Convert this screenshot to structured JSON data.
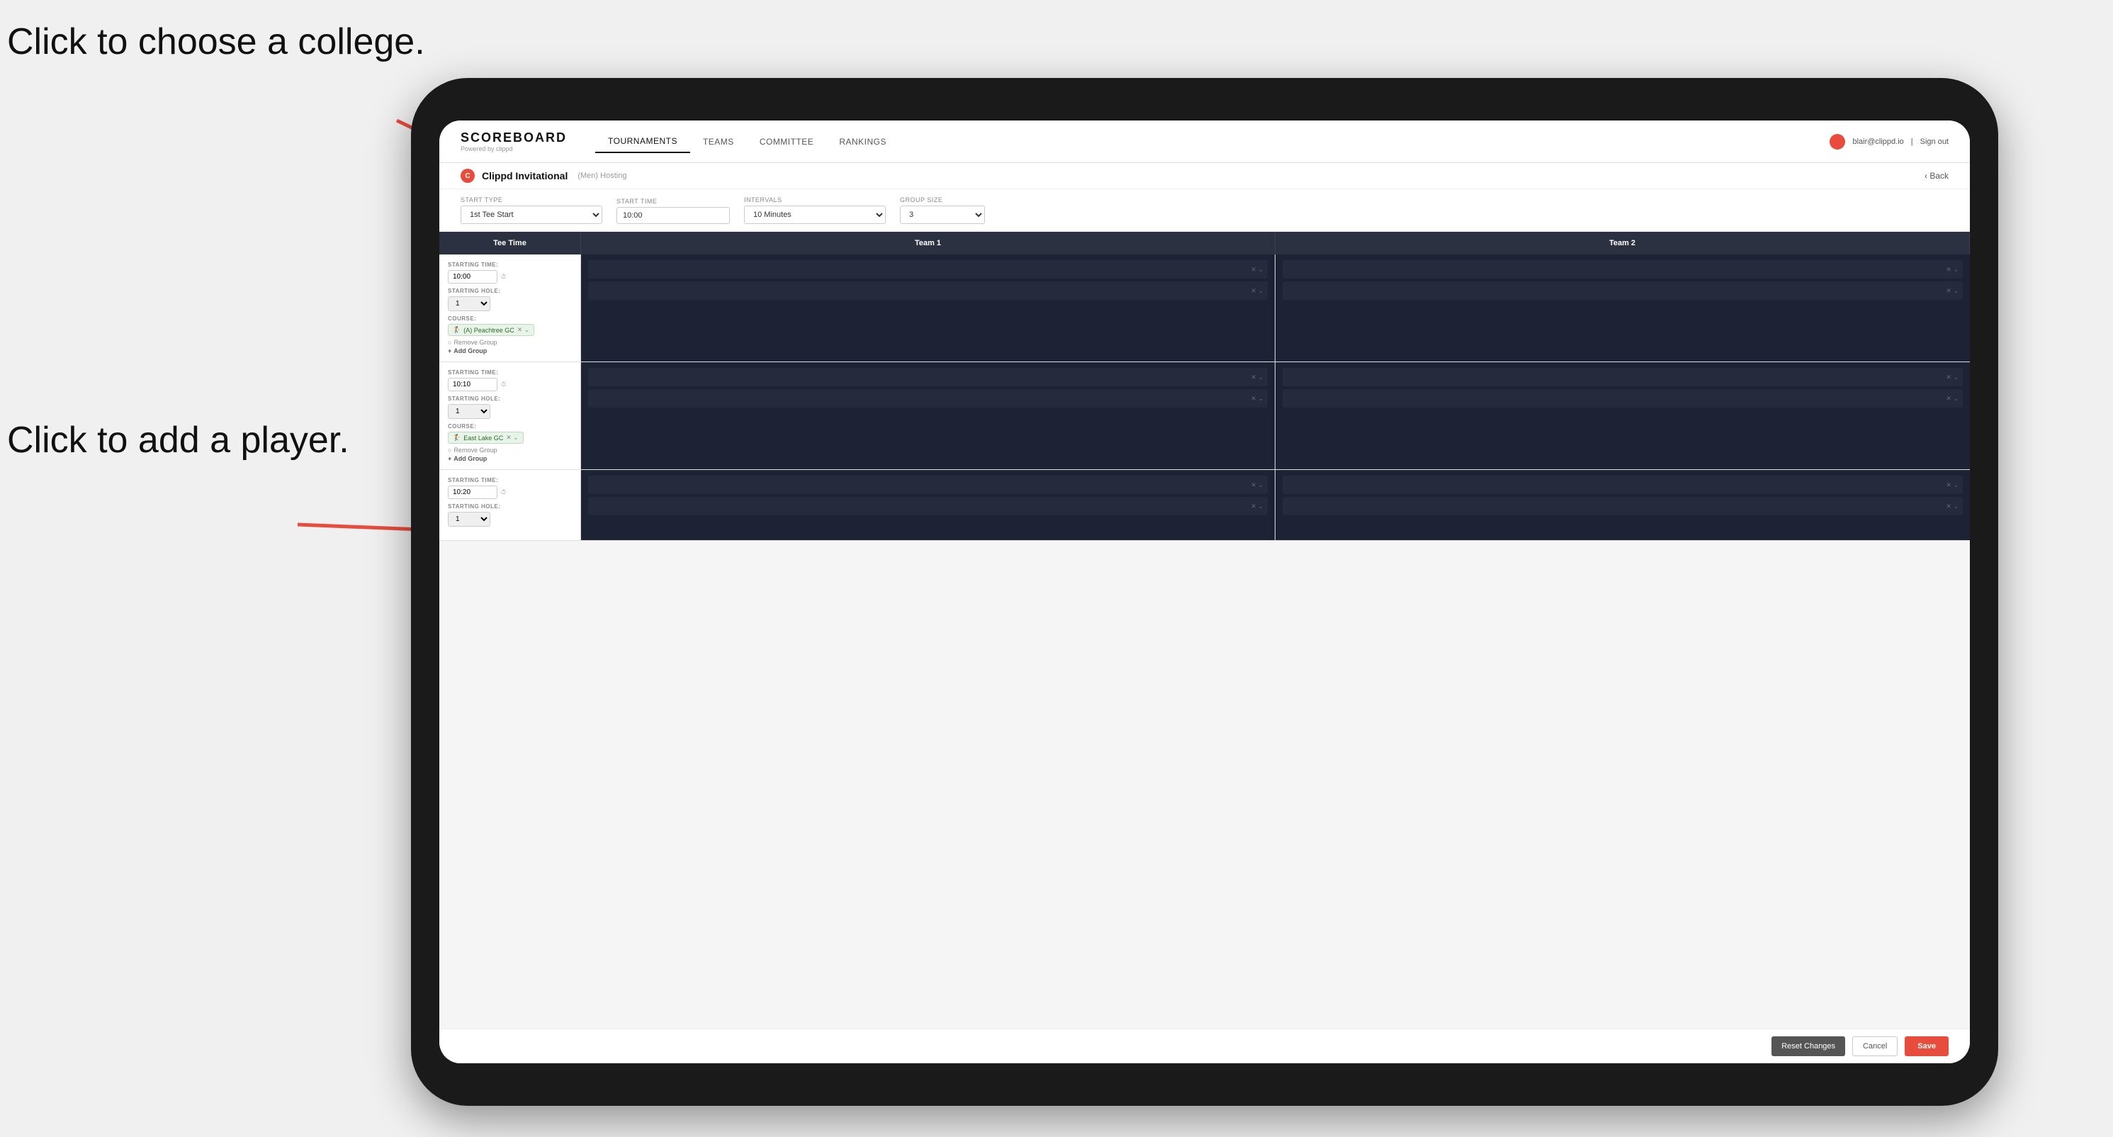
{
  "annotations": {
    "click_college": "Click to choose a college.",
    "click_player": "Click to add a player."
  },
  "nav": {
    "brand": "SCOREBOARD",
    "brand_sub": "Powered by clippd",
    "links": [
      "TOURNAMENTS",
      "TEAMS",
      "COMMITTEE",
      "RANKINGS"
    ],
    "active_link": "TOURNAMENTS",
    "user_email": "blair@clippd.io",
    "sign_out": "Sign out"
  },
  "sub_header": {
    "title": "Clippd Invitational",
    "men": "(Men)",
    "hosting": "Hosting",
    "back": "Back"
  },
  "form": {
    "start_type_label": "Start Type",
    "start_type_value": "1st Tee Start",
    "start_time_label": "Start Time",
    "start_time_value": "10:00",
    "intervals_label": "Intervals",
    "intervals_value": "10 Minutes",
    "group_size_label": "Group Size",
    "group_size_value": "3"
  },
  "table": {
    "col_tee_time": "Tee Time",
    "col_team1": "Team 1",
    "col_team2": "Team 2"
  },
  "rows": [
    {
      "starting_time": "10:00",
      "starting_hole": "1",
      "course": "(A) Peachtree GC",
      "course_type": "peachtree",
      "has_remove_group": true,
      "has_add_group": true,
      "team1_players": 2,
      "team2_players": 2
    },
    {
      "starting_time": "10:10",
      "starting_hole": "1",
      "course": "East Lake GC",
      "course_type": "east_lake",
      "has_remove_group": true,
      "has_add_group": true,
      "team1_players": 2,
      "team2_players": 2
    },
    {
      "starting_time": "10:20",
      "starting_hole": "1",
      "course": "",
      "course_type": "",
      "has_remove_group": false,
      "has_add_group": false,
      "team1_players": 2,
      "team2_players": 2
    }
  ],
  "labels": {
    "starting_time": "STARTING TIME:",
    "starting_hole": "STARTING HOLE:",
    "course": "COURSE:",
    "remove_group": "Remove Group",
    "add_group": "Add Group"
  },
  "footer": {
    "reset_label": "Reset Changes",
    "cancel_label": "Cancel",
    "save_label": "Save"
  },
  "colors": {
    "accent": "#e74c3c",
    "dark_bg": "#1e2235",
    "nav_bg": "#2c3142"
  }
}
